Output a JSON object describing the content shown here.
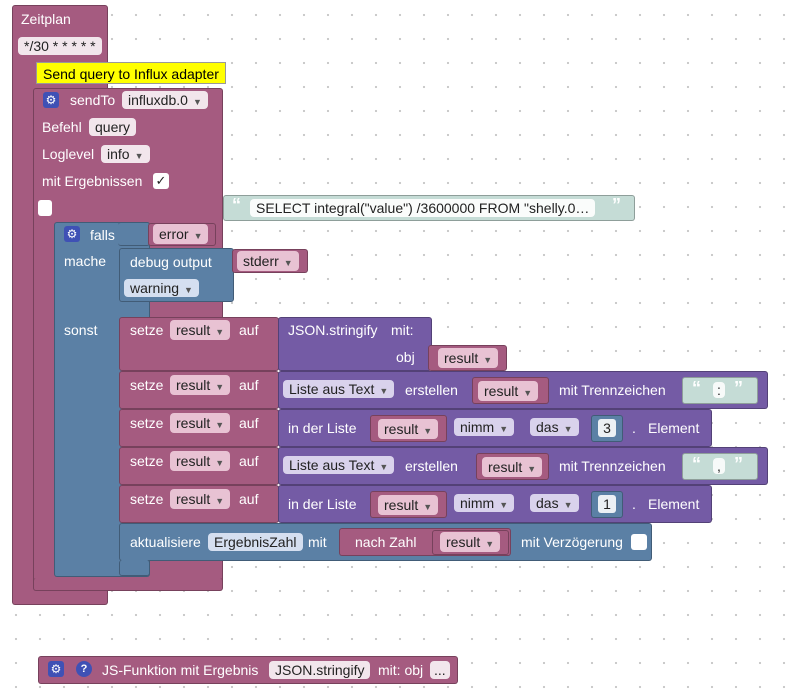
{
  "schedule": {
    "title": "Zeitplan",
    "cron": "*/30 * * * * *"
  },
  "tooltip": "Send query to Influx adapter",
  "sendto": {
    "label": "sendTo",
    "target": "influxdb.0",
    "command_label": "Befehl",
    "command": "query",
    "loglevel_label": "Loglevel",
    "loglevel": "info",
    "results_label": "mit Ergebnissen",
    "results_check": "✓",
    "query_text": "SELECT integral(\"value\") /3600000 FROM \"shelly.0…"
  },
  "ifblock": {
    "label": "falls",
    "condition": "error",
    "do_label": "mache",
    "else_label": "sonst",
    "debug_label": "debug output",
    "debug_target": "stderr",
    "debug_level": "warning"
  },
  "statements": [
    {
      "set": "setze",
      "var": "result",
      "to": "auf",
      "func": "JSON.stringify",
      "with": "mit:",
      "obj_label": "obj",
      "obj_var": "result"
    },
    {
      "set": "setze",
      "var": "result",
      "to": "auf",
      "op": "Liste aus Text",
      "create": "erstellen",
      "src": "result",
      "sep_label": "mit Trennzeichen",
      "sep": ":"
    },
    {
      "set": "setze",
      "var": "result",
      "to": "auf",
      "inlist": "in der Liste",
      "src": "result",
      "take": "nimm",
      "which": "das",
      "index": "3",
      "dot": ".",
      "elem": "Element"
    },
    {
      "set": "setze",
      "var": "result",
      "to": "auf",
      "op": "Liste aus Text",
      "create": "erstellen",
      "src": "result",
      "sep_label": "mit Trennzeichen",
      "sep": ","
    },
    {
      "set": "setze",
      "var": "result",
      "to": "auf",
      "inlist": "in der Liste",
      "src": "result",
      "take": "nimm",
      "which": "das",
      "index": "1",
      "dot": ".",
      "elem": "Element"
    }
  ],
  "update": {
    "label": "aktualisiere",
    "state": "ErgebnisZahl",
    "with": "mit",
    "cast": "nach Zahl",
    "var": "result",
    "delay": "mit Verzögerung"
  },
  "footer": {
    "label": "JS-Funktion mit Ergebnis",
    "func": "JSON.stringify",
    "args": "mit: obj",
    "more": "..."
  },
  "icons": {
    "gear": "⚙",
    "help": "?",
    "dropdown": "▼",
    "open_quote": "“",
    "close_quote": "”"
  }
}
